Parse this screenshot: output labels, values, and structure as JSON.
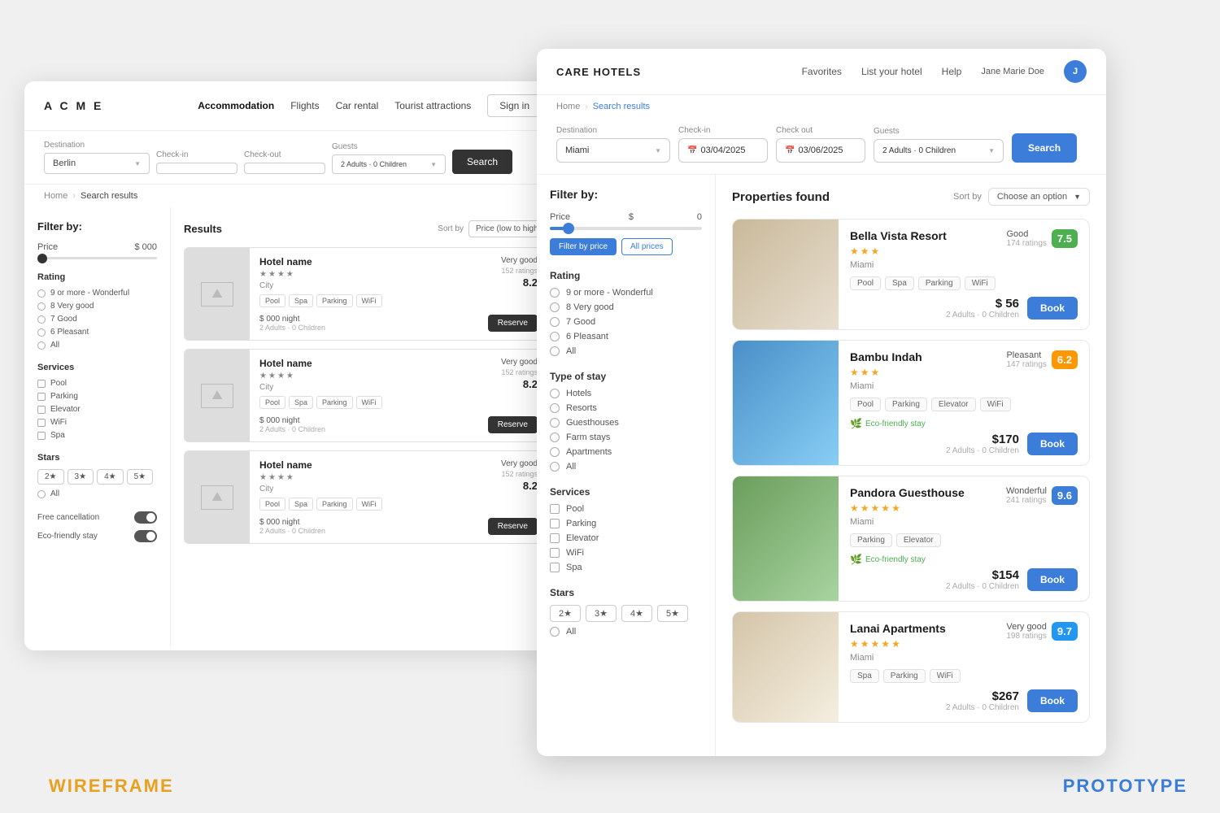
{
  "labels": {
    "wireframe": "WIREFRAME",
    "prototype": "PROTOTYPE"
  },
  "wireframe": {
    "logo": "A C M E",
    "nav": {
      "items": [
        "Accommodation",
        "Flights",
        "Car rental",
        "Tourist attractions"
      ],
      "active": "Accommodation",
      "sign_in": "Sign in"
    },
    "search": {
      "destination_label": "Destination",
      "destination_value": "Berlin",
      "checkin_label": "Check-in",
      "checkout_label": "Check-out",
      "guests_label": "Guests",
      "guests_value": "2 Adults · 0 Children",
      "search_btn": "Search"
    },
    "breadcrumb": {
      "home": "Home",
      "current": "Search results"
    },
    "filters": {
      "title": "Filter by:",
      "price": {
        "label": "Price",
        "value": "$ 000"
      },
      "rating": {
        "title": "Rating",
        "options": [
          "9 or more - Wonderful",
          "8 Very good",
          "7 Good",
          "6 Pleasant",
          "All"
        ]
      },
      "services": {
        "title": "Services",
        "options": [
          "Pool",
          "Parking",
          "Elevator",
          "WiFi",
          "Spa"
        ]
      },
      "stars": {
        "title": "Stars",
        "options": [
          "2★",
          "3★",
          "4★",
          "5★"
        ],
        "all": "All"
      },
      "free_cancellation": "Free cancellation",
      "eco_friendly": "Eco-friendly stay"
    },
    "results": {
      "title": "Results",
      "sort_label": "Sort by",
      "sort_value": "Price (low to high)",
      "hotels": [
        {
          "name": "Hotel name",
          "rating_label": "Very good",
          "rating_count": "152 ratings",
          "rating_score": "8.2",
          "city": "City",
          "amenities": [
            "Pool",
            "Spa",
            "Parking",
            "WiFi"
          ],
          "price": "$ 000 night",
          "guests": "2 Adults · 0 Children",
          "reserve_btn": "Reserve"
        },
        {
          "name": "Hotel name",
          "rating_label": "Very good",
          "rating_count": "152 ratings",
          "rating_score": "8.2",
          "city": "City",
          "amenities": [
            "Pool",
            "Spa",
            "Parking",
            "WiFi"
          ],
          "price": "$ 000 night",
          "guests": "2 Adults · 0 Children",
          "reserve_btn": "Reserve"
        },
        {
          "name": "Hotel name",
          "rating_label": "Very good",
          "rating_count": "152 ratings",
          "rating_score": "8.2",
          "city": "City",
          "amenities": [
            "Pool",
            "Spa",
            "Parking",
            "WiFi"
          ],
          "price": "$ 000 night",
          "guests": "2 Adults · 0 Children",
          "reserve_btn": "Reserve"
        }
      ]
    }
  },
  "prototype": {
    "logo": "CARE HOTELS",
    "nav": {
      "favorites": "Favorites",
      "list_hotel": "List your hotel",
      "help": "Help",
      "user_name": "Jane Marie Doe"
    },
    "breadcrumb": {
      "home": "Home",
      "current": "Search results"
    },
    "search": {
      "destination_label": "Destination",
      "destination_value": "Miami",
      "checkin_label": "Check-in",
      "checkin_value": "03/04/2025",
      "checkout_label": "Check out",
      "checkout_value": "03/06/2025",
      "guests_label": "Guests",
      "guests_value": "2 Adults · 0 Children",
      "search_btn": "Search"
    },
    "filters": {
      "title": "Filter by:",
      "price": {
        "label": "Price",
        "icon": "$",
        "value": "0"
      },
      "price_btns": [
        "Filter by price",
        "All prices"
      ],
      "rating": {
        "title": "Rating",
        "options": [
          "9 or more - Wonderful",
          "8 Very good",
          "7 Good",
          "6 Pleasant",
          "All"
        ]
      },
      "type_of_stay": {
        "title": "Type of stay",
        "options": [
          "Hotels",
          "Resorts",
          "Guesthouses",
          "Farm stays",
          "Apartments",
          "All"
        ]
      },
      "services": {
        "title": "Services",
        "options": [
          "Pool",
          "Parking",
          "Elevator",
          "WiFi",
          "Spa"
        ]
      },
      "stars": {
        "title": "Stars",
        "options": [
          "2★",
          "3★",
          "4★",
          "5★"
        ],
        "all": "All"
      }
    },
    "results": {
      "title": "Properties found",
      "sort_label": "Sort by",
      "sort_value": "Choose an option",
      "hotels": [
        {
          "name": "Bella Vista Resort",
          "stars": 3,
          "city": "Miami",
          "rating_label": "Good",
          "rating_count": "174 ratings",
          "rating_score": "7.5",
          "rating_class": "good",
          "amenities": [
            "Pool",
            "Spa",
            "Parking",
            "WiFi"
          ],
          "price": "$ 56",
          "guests": "2 Adults · 0 Children",
          "book_btn": "Book",
          "eco": false
        },
        {
          "name": "Bambu Indah",
          "stars": 3,
          "city": "Miami",
          "rating_label": "Pleasant",
          "rating_count": "147 ratings",
          "rating_score": "6.2",
          "rating_class": "pleasant",
          "amenities": [
            "Pool",
            "Parking",
            "Elevator",
            "WiFi"
          ],
          "price": "$170",
          "guests": "2 Adults · 0 Children",
          "book_btn": "Book",
          "eco": true,
          "eco_label": "Eco-friendly stay"
        },
        {
          "name": "Pandora Guesthouse",
          "stars": 5,
          "city": "Miami",
          "rating_label": "Wonderful",
          "rating_count": "241 ratings",
          "rating_score": "9.6",
          "rating_class": "wonderful",
          "amenities": [
            "Parking",
            "Elevator"
          ],
          "price": "$154",
          "guests": "2 Adults · 0 Children",
          "book_btn": "Book",
          "eco": true,
          "eco_label": "Eco-friendly stay"
        },
        {
          "name": "Lanai Apartments",
          "stars": 5,
          "city": "Miami",
          "rating_label": "Very good",
          "rating_count": "198 ratings",
          "rating_score": "9.7",
          "rating_class": "very-good",
          "amenities": [
            "Spa",
            "Parking",
            "WiFi"
          ],
          "price": "$267",
          "guests": "2 Adults · 0 Children",
          "book_btn": "Book",
          "eco": false
        }
      ]
    }
  }
}
